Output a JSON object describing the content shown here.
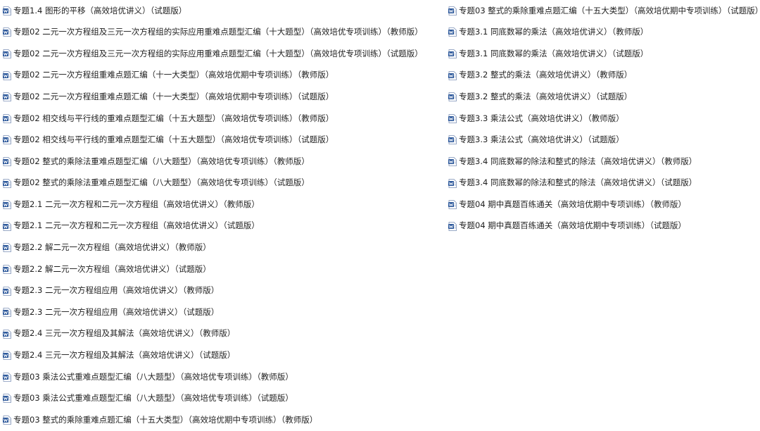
{
  "file_icon": "word-document-icon",
  "accent_color": "#2b579a",
  "files_left": [
    "专题1.4 图形的平移（高效培优讲义）（试题版）",
    "专题02 二元一次方程组及三元一次方程组的实际应用重难点题型汇编（十大题型）（高效培优专项训练）（教师版）",
    "专题02 二元一次方程组及三元一次方程组的实际应用重难点题型汇编（十大题型）（高效培优专项训练）（试题版）",
    "专题02 二元一次方程组重难点题汇编（十一大类型）（高效培优期中专项训练）（教师版）",
    "专题02 二元一次方程组重难点题汇编（十一大类型）（高效培优期中专项训练）（试题版）",
    "专题02 相交线与平行线的重难点题型汇编（十五大题型）（高效培优专项训练）（教师版）",
    "专题02 相交线与平行线的重难点题型汇编（十五大题型）（高效培优专项训练）（试题版）",
    "专题02 整式的乘除法重难点题型汇编（八大题型）（高效培优专项训练）（教师版）",
    "专题02 整式的乘除法重难点题型汇编（八大题型）（高效培优专项训练）（试题版）",
    "专题2.1 二元一次方程和二元一次方程组（高效培优讲义）（教师版）",
    "专题2.1 二元一次方程和二元一次方程组（高效培优讲义）（试题版）",
    "专题2.2 解二元一次方程组（高效培优讲义）（教师版）",
    "专题2.2 解二元一次方程组（高效培优讲义）（试题版）",
    "专题2.3 二元一次方程组应用（高效培优讲义）（教师版）",
    "专题2.3 二元一次方程组应用（高效培优讲义）（试题版）",
    "专题2.4 三元一次方程组及其解法（高效培优讲义）（教师版）",
    "专题2.4 三元一次方程组及其解法（高效培优讲义）（试题版）",
    "专题03 乘法公式重难点题型汇编（八大题型）（高效培优专项训练）（教师版）",
    "专题03 乘法公式重难点题型汇编（八大题型）（高效培优专项训练）（试题版）",
    "专题03 整式的乘除重难点题汇编（十五大类型）（高效培优期中专项训练）（教师版）"
  ],
  "files_right": [
    "专题03 整式的乘除重难点题汇编（十五大类型）（高效培优期中专项训练）（试题版）",
    "专题3.1 同底数幂的乘法（高效培优讲义）（教师版）",
    "专题3.1 同底数幂的乘法（高效培优讲义）（试题版）",
    "专题3.2 整式的乘法（高效培优讲义）（教师版）",
    "专题3.2 整式的乘法（高效培优讲义）（试题版）",
    "专题3.3 乘法公式（高效培优讲义）（教师版）",
    "专题3.3 乘法公式（高效培优讲义）（试题版）",
    "专题3.4 同底数幂的除法和整式的除法（高效培优讲义）（教师版）",
    "专题3.4 同底数幂的除法和整式的除法（高效培优讲义）（试题版）",
    "专题04 期中真题百练通关（高效培优期中专项训练）（教师版）",
    "专题04 期中真题百练通关（高效培优期中专项训练）（试题版）"
  ]
}
